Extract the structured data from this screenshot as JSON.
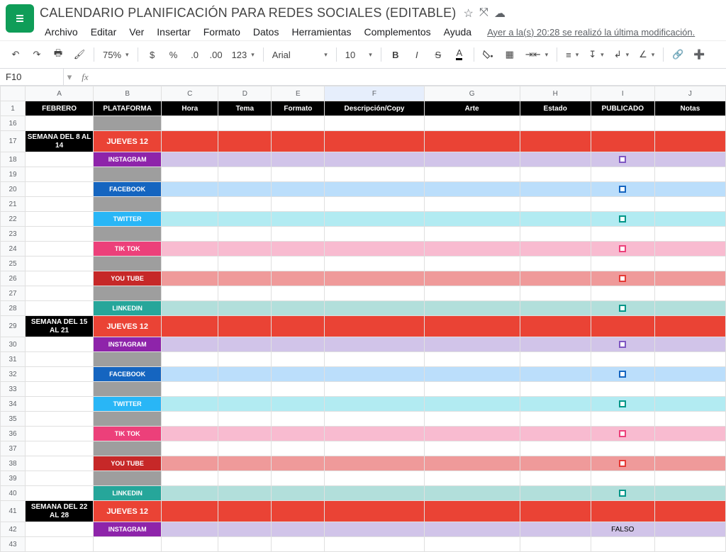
{
  "doc": {
    "title": "CALENDARIO PLANIFICACIÓN PARA REDES SOCIALES (EDITABLE)",
    "last_edit": "Ayer a la(s) 20:28 se realizó la última modificación."
  },
  "menu": {
    "archivo": "Archivo",
    "editar": "Editar",
    "ver": "Ver",
    "insertar": "Insertar",
    "formato": "Formato",
    "datos": "Datos",
    "herramientas": "Herramientas",
    "complementos": "Complementos",
    "ayuda": "Ayuda"
  },
  "toolbar": {
    "zoom": "75%",
    "font": "Arial",
    "size": "10",
    "more": "123"
  },
  "namebox": "F10",
  "columns": [
    "A",
    "B",
    "C",
    "D",
    "E",
    "F",
    "G",
    "H",
    "I",
    "J"
  ],
  "headers": {
    "A": "FEBRERO",
    "B": "PLATAFORMA",
    "C": "Hora",
    "D": "Tema",
    "E": "Formato",
    "F": "Descripción/Copy",
    "G": "Arte",
    "H": "Estado",
    "I": "PUBLICADO",
    "J": "Notas"
  },
  "colors": {
    "instagram_bg": "#8e24aa",
    "instagram_light": "#d1c4e9",
    "instagram_check": "#7e57c2",
    "facebook_bg": "#1565c0",
    "facebook_light": "#bbdefb",
    "facebook_check": "#1565c0",
    "twitter_bg": "#29b6f6",
    "twitter_light": "#b2ebf2",
    "twitter_check": "#009688",
    "tiktok_bg": "#ec407a",
    "tiktok_light": "#f8bbd0",
    "tiktok_check": "#ec407a",
    "youtube_bg": "#c62828",
    "youtube_light": "#ef9a9a",
    "youtube_check": "#e53935",
    "linkedin_bg": "#26a69a",
    "linkedin_light": "#b2dfdb",
    "linkedin_check": "#009688"
  },
  "rows": [
    {
      "n": 16,
      "type": "blank",
      "bgB": "#9e9e9e"
    },
    {
      "n": 17,
      "type": "week",
      "week": "SEMANA DEL 8 AL 14",
      "day": "JUEVES 12",
      "tall": true
    },
    {
      "n": 18,
      "type": "platform",
      "p": "instagram",
      "label": "INSTAGRAM"
    },
    {
      "n": 19,
      "type": "gap"
    },
    {
      "n": 20,
      "type": "platform",
      "p": "facebook",
      "label": "FACEBOOK"
    },
    {
      "n": 21,
      "type": "gap"
    },
    {
      "n": 22,
      "type": "platform",
      "p": "twitter",
      "label": "TWITTER"
    },
    {
      "n": 23,
      "type": "gap"
    },
    {
      "n": 24,
      "type": "platform",
      "p": "tiktok",
      "label": "TIK TOK"
    },
    {
      "n": 25,
      "type": "gap"
    },
    {
      "n": 26,
      "type": "platform",
      "p": "youtube",
      "label": "YOU TUBE"
    },
    {
      "n": 27,
      "type": "gap"
    },
    {
      "n": 28,
      "type": "platform",
      "p": "linkedin",
      "label": "LINKEDIN"
    },
    {
      "n": 29,
      "type": "week",
      "week": "SEMANA DEL 15 AL 21",
      "day": "JUEVES 12",
      "tall": true
    },
    {
      "n": 30,
      "type": "platform",
      "p": "instagram",
      "label": "INSTAGRAM"
    },
    {
      "n": 31,
      "type": "gap"
    },
    {
      "n": 32,
      "type": "platform",
      "p": "facebook",
      "label": "FACEBOOK"
    },
    {
      "n": 33,
      "type": "gap"
    },
    {
      "n": 34,
      "type": "platform",
      "p": "twitter",
      "label": "TWITTER"
    },
    {
      "n": 35,
      "type": "gap"
    },
    {
      "n": 36,
      "type": "platform",
      "p": "tiktok",
      "label": "TIK TOK"
    },
    {
      "n": 37,
      "type": "gap"
    },
    {
      "n": 38,
      "type": "platform",
      "p": "youtube",
      "label": "YOU TUBE"
    },
    {
      "n": 39,
      "type": "gap"
    },
    {
      "n": 40,
      "type": "platform",
      "p": "linkedin",
      "label": "LINKEDIN"
    },
    {
      "n": 41,
      "type": "week",
      "week": "SEMANA DEL 22  AL 28",
      "day": "JUEVES 12",
      "tall": true
    },
    {
      "n": 42,
      "type": "platform",
      "p": "instagram",
      "label": "INSTAGRAM",
      "iText": "FALSO"
    },
    {
      "n": 43,
      "type": "blank"
    }
  ]
}
